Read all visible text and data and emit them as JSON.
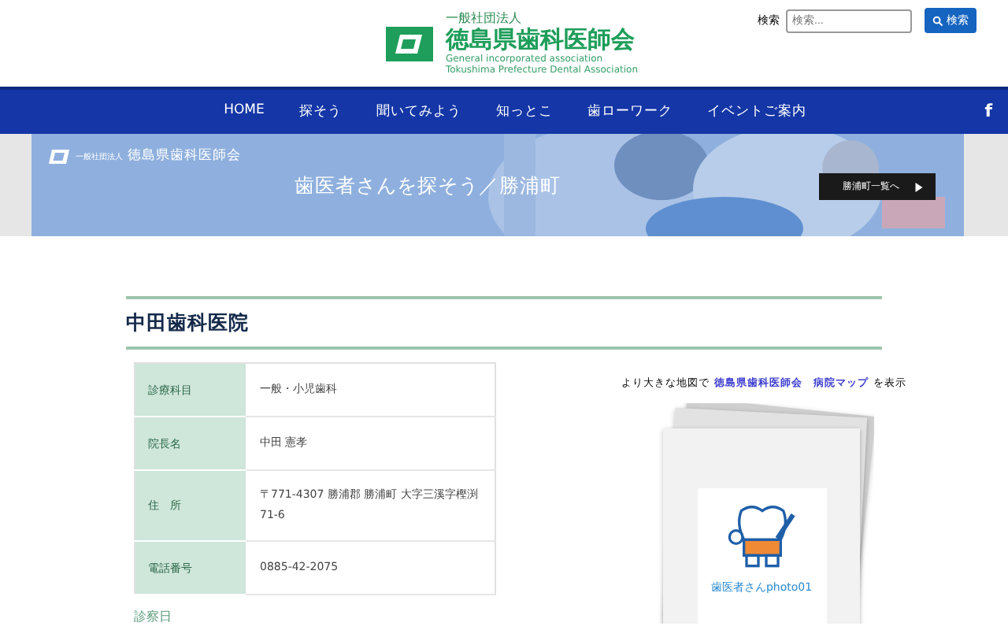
{
  "header": {
    "org_type": "一般社団法人",
    "org_name": "徳島県歯科医師会",
    "english_lines": [
      "General incorporated association",
      "Tokushima Prefecture Dental Association"
    ],
    "search": {
      "label": "検索",
      "placeholder": "検索...",
      "button": "検索"
    }
  },
  "nav": {
    "items": [
      {
        "label": "HOME"
      },
      {
        "label": "探そう"
      },
      {
        "label": "聞いてみよう"
      },
      {
        "label": "知っとこ"
      },
      {
        "label": "歯ローワーク"
      },
      {
        "label": "イベントご案内"
      }
    ],
    "social": "f"
  },
  "banner": {
    "org_type": "一般社団法人",
    "org_name": "徳島県歯科医師会",
    "title": "歯医者さんを探そう／勝浦町",
    "button": "勝浦町一覧へ"
  },
  "clinic": {
    "name": "中田歯科医院",
    "details": [
      {
        "label": "診療科目",
        "value": "一般・小児歯科"
      },
      {
        "label": "院長名",
        "value": "中田 憲孝"
      },
      {
        "label": "住　所",
        "value": "〒771-4307 勝浦郡 勝浦町 大字三溪字樫渕71-6"
      },
      {
        "label": "電話番号",
        "value": "0885-42-2075"
      }
    ],
    "section": "診察日"
  },
  "map": {
    "prefix": "より大きな地図で",
    "link": "徳島県歯科医師会　病院マップ",
    "suffix": "を表示"
  },
  "photo": {
    "caption": "歯医者さんphoto01"
  }
}
